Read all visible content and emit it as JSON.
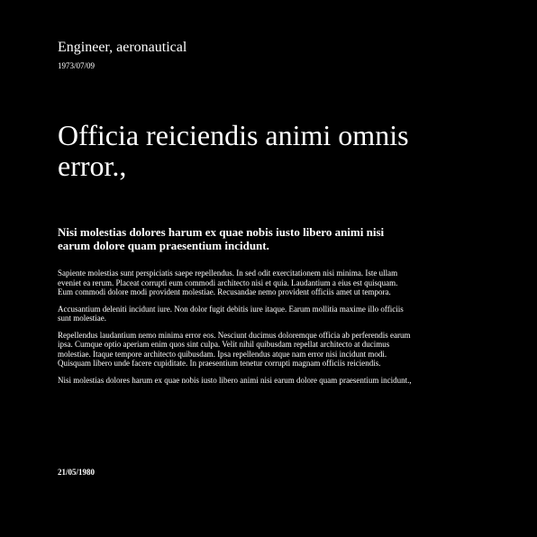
{
  "document": {
    "author_title": "Engineer, aeronautical",
    "top_date": "1973/07/09",
    "headline": "Officia reiciendis animi omnis error.,",
    "subheading": "Nisi molestias dolores harum ex quae nobis iusto libero animi nisi earum dolore quam praesentium incidunt.",
    "paragraphs": [
      "Sapiente molestias sunt perspiciatis saepe repellendus. In sed odit exercitationem nisi minima. Iste ullam eveniet ea rerum. Placeat corrupti eum commodi architecto nisi et quia. Laudantium a eius est quisquam. Eum commodi dolore modi provident molestiae. Recusandae nemo provident officiis amet ut tempora.",
      "Accusantium deleniti incidunt iure. Non dolor fugit debitis iure itaque. Earum mollitia maxime illo officiis sunt molestiae.",
      "Repellendus laudantium nemo minima error eos. Nesciunt ducimus doloremque officia ab perferendis earum ipsa. Cumque optio aperiam enim quos sint culpa. Velit nihil quibusdam repellat architecto at ducimus molestiae. Itaque tempore architecto quibusdam. Ipsa repellendus atque nam error nisi incidunt modi. Quisquam libero unde facere cupiditate. In praesentium tenetur corrupti magnam officiis reiciendis.",
      "Nisi molestias dolores harum ex quae nobis iusto libero animi nisi earum dolore quam praesentium incidunt.,"
    ],
    "bottom_date": "21/05/1980"
  },
  "colors": {
    "background": "#000000",
    "text": "#ffffff"
  }
}
